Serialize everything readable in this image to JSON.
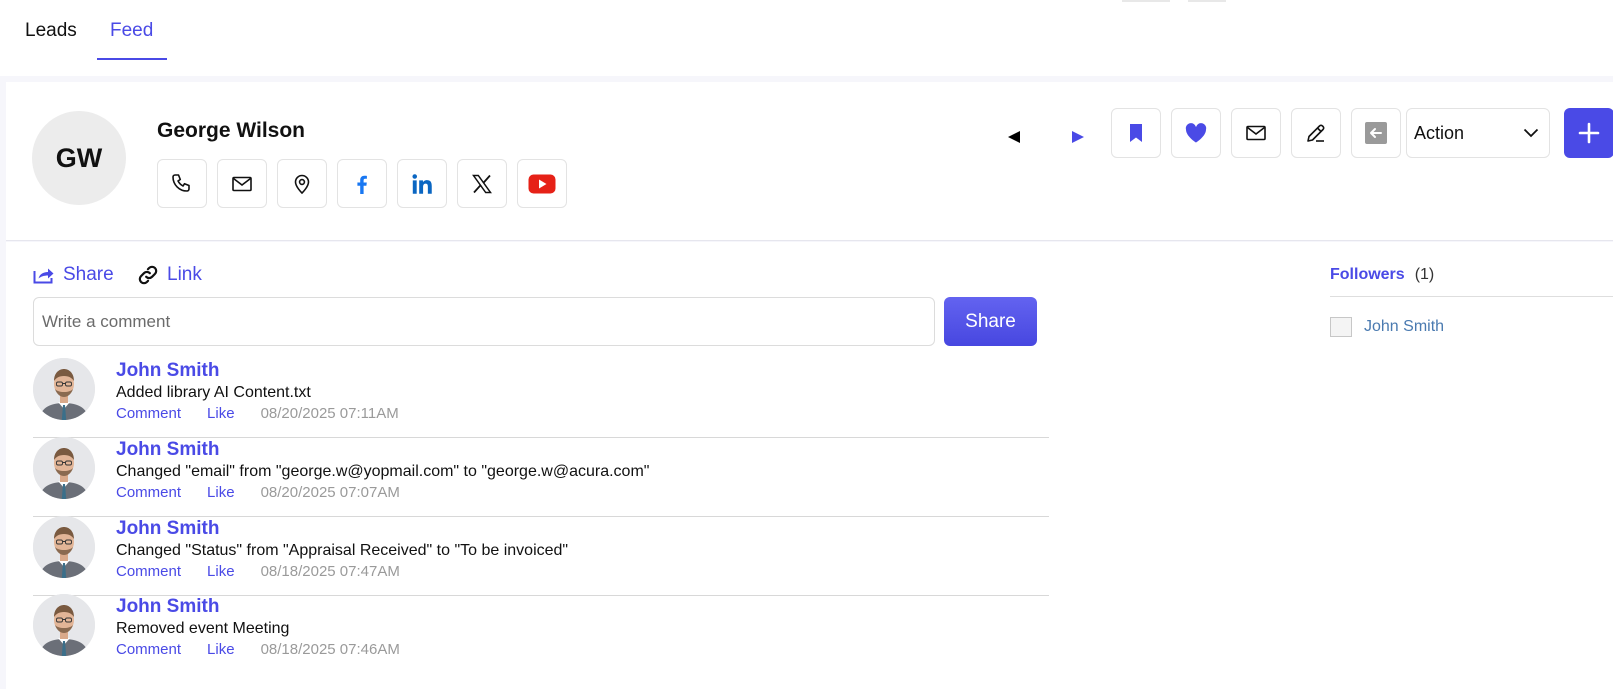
{
  "tabs": [
    {
      "label": "Leads",
      "active": false
    },
    {
      "label": "Feed",
      "active": true
    }
  ],
  "lead": {
    "initials": "GW",
    "name": "George Wilson"
  },
  "contact_icons": [
    "phone-icon",
    "mail-icon",
    "location-icon",
    "facebook-icon",
    "linkedin-icon",
    "x-icon",
    "youtube-icon"
  ],
  "toolbar": {
    "action_label": "Action"
  },
  "feed": {
    "share_label": "Share",
    "link_label": "Link",
    "comment_placeholder": "Write a comment",
    "comment_value": "",
    "share_button_label": "Share"
  },
  "activities": [
    {
      "user": "John Smith",
      "text": "Added library AI Content.txt",
      "comment": "Comment",
      "like": "Like",
      "time": "08/20/2025 07:11AM"
    },
    {
      "user": "John Smith",
      "text": "Changed \"email\" from \"george.w@yopmail.com\" to \"george.w@acura.com\"",
      "comment": "Comment",
      "like": "Like",
      "time": "08/20/2025 07:07AM"
    },
    {
      "user": "John Smith",
      "text": "Changed \"Status\" from \"Appraisal Received\" to \"To be invoiced\"",
      "comment": "Comment",
      "like": "Like",
      "time": "08/18/2025 07:47AM"
    },
    {
      "user": "John Smith",
      "text": "Removed event Meeting",
      "comment": "Comment",
      "like": "Like",
      "time": "08/18/2025 07:46AM"
    }
  ],
  "followers": {
    "title": "Followers",
    "count": "(1)",
    "items": [
      {
        "name": "John Smith"
      }
    ]
  },
  "colors": {
    "accent": "#4a4ae6",
    "facebook": "#1877f2",
    "linkedin": "#0a66c2",
    "youtube": "#e62117",
    "muted": "#9a9a9a"
  }
}
